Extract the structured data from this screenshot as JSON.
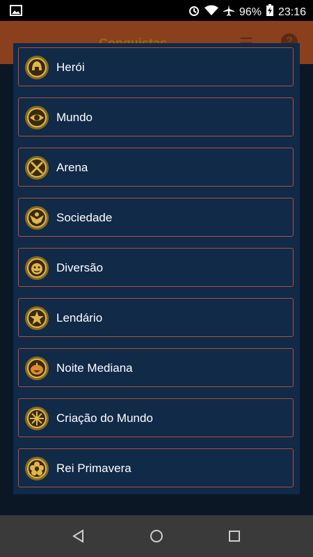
{
  "status_bar": {
    "battery": "96%",
    "time": "23:16"
  },
  "app_bar": {
    "title": "Conquistas"
  },
  "categories": [
    {
      "label": "Herói",
      "icon": "helmet-icon"
    },
    {
      "label": "Mundo",
      "icon": "eye-icon"
    },
    {
      "label": "Arena",
      "icon": "crossed-swords-icon"
    },
    {
      "label": "Sociedade",
      "icon": "eagle-icon"
    },
    {
      "label": "Diversão",
      "icon": "jester-mask-icon"
    },
    {
      "label": "Lendário",
      "icon": "star-icon"
    },
    {
      "label": "Noite Mediana",
      "icon": "pumpkin-icon"
    },
    {
      "label": "Criação do Mundo",
      "icon": "ornament-icon"
    },
    {
      "label": "Rei Primavera",
      "icon": "flower-icon"
    }
  ],
  "colors": {
    "dialog_bg": "#102a48",
    "item_border": "#b0513a",
    "badge_gold": "#c9a13b"
  }
}
